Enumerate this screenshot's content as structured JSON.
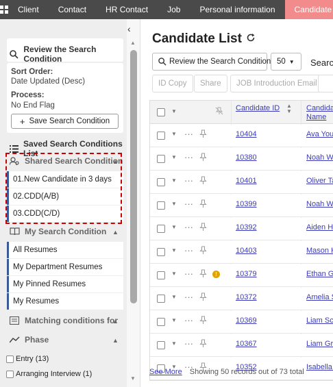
{
  "nav": {
    "tabs": [
      "Client",
      "Contact",
      "HR Contact",
      "Job",
      "Personal information",
      "Candidate"
    ],
    "active_tab": "Candidate",
    "active_color": "#f28c8c"
  },
  "sidebar": {
    "review_label": "Review the Search Condition",
    "sort_order_label": "Sort Order:",
    "sort_order_value": "Date Updated (Desc)",
    "process_label": "Process:",
    "process_value": "No End Flag",
    "save_button": "Save Search Condition",
    "saved_list_label": "Saved Search Conditions List",
    "shared_label": "Shared Search Condition",
    "shared_items": [
      "01.New Candidate in 3 days",
      "02.CDD(A/B)",
      "03.CDD(C/D)"
    ],
    "my_label": "My Search Condition",
    "my_items": [
      "All Resumes",
      "My Department Resumes",
      "My Pinned Resumes",
      "My Resumes"
    ],
    "matching_label": "Matching conditions for",
    "phase_label": "Phase",
    "phase_items": [
      "Entry (13)",
      "Arranging Interview (1)"
    ]
  },
  "main": {
    "title": "Candidate List",
    "review_button": "Review the Search Condition",
    "page_size": "50",
    "search_label": "Search",
    "action_buttons": [
      "ID Copy",
      "Share",
      "JOB Introduction Email"
    ],
    "col_id": "Candidate ID",
    "col_name_line1": "Candidate",
    "col_name_line2": "Name",
    "rows": [
      {
        "id": "10404",
        "name": "Ava Young"
      },
      {
        "id": "10380",
        "name": "Noah White"
      },
      {
        "id": "10401",
        "name": "Oliver Taylor"
      },
      {
        "id": "10399",
        "name": "Noah Wilkins"
      },
      {
        "id": "10392",
        "name": "Aiden Hayes"
      },
      {
        "id": "10403",
        "name": "Mason King"
      },
      {
        "id": "10379",
        "name": "Ethan Green",
        "warning": true
      },
      {
        "id": "10372",
        "name": "Amelia Scott"
      },
      {
        "id": "10369",
        "name": "Liam Scott"
      },
      {
        "id": "10367",
        "name": "Liam Green"
      },
      {
        "id": "10352",
        "name": "Isabella Moore"
      }
    ],
    "see_more": "See More",
    "records_text": "Showing 50 records out of 73 total"
  }
}
